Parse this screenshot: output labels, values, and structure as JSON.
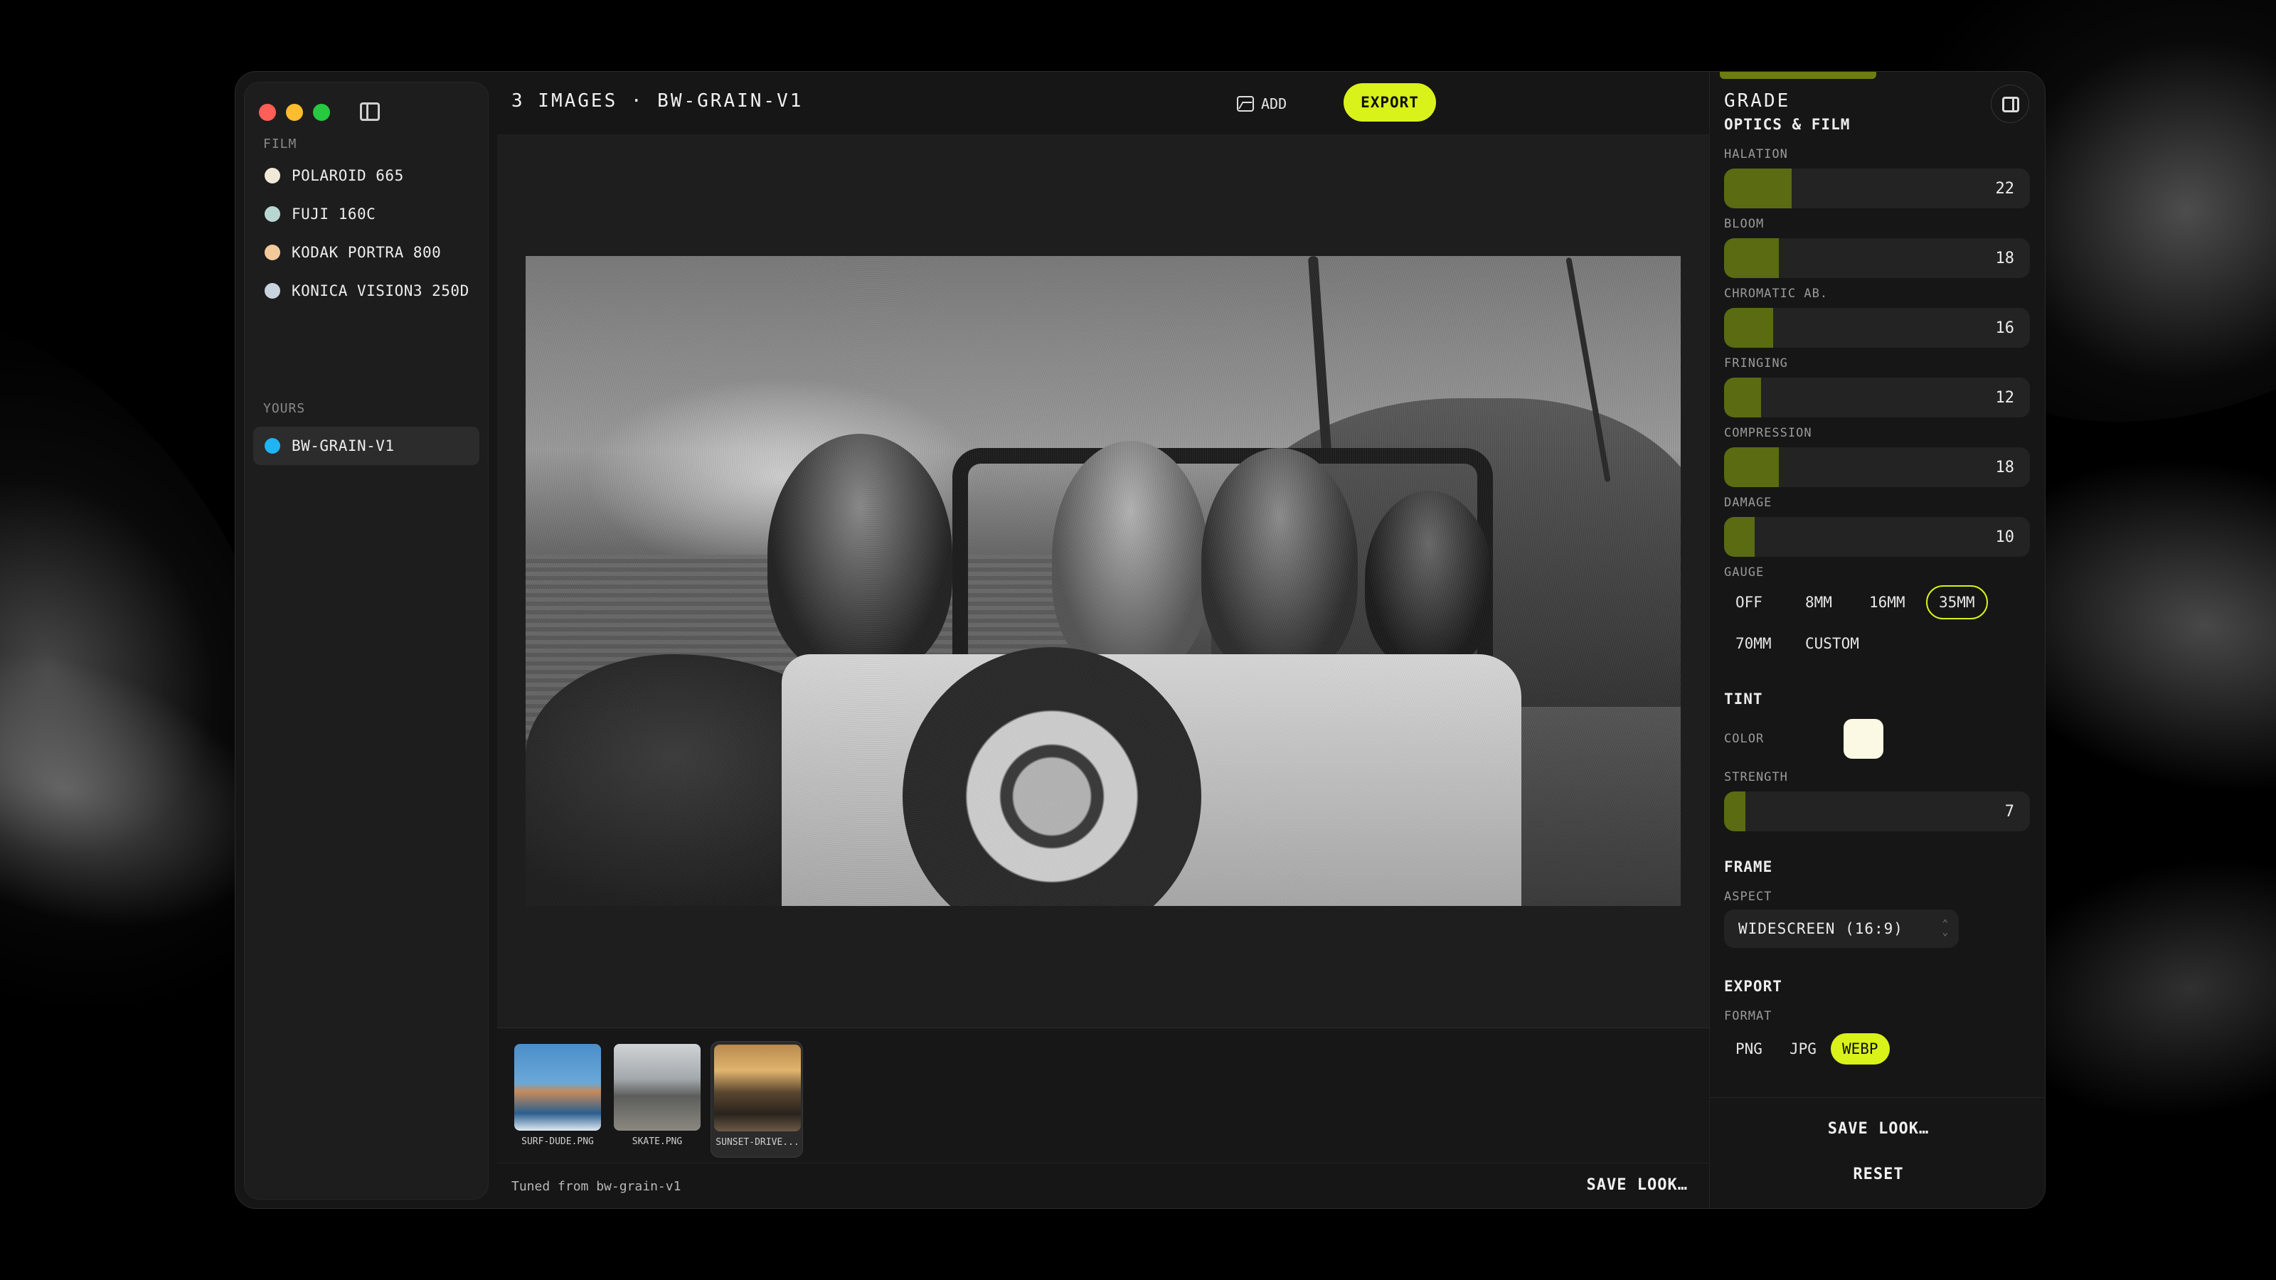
{
  "window": {
    "title": "3 IMAGES · BW-GRAIN-V1",
    "traffic_lights": [
      "#ff5f57",
      "#febc2e",
      "#28c840"
    ]
  },
  "sidebar": {
    "film_label": "FILM",
    "film_items": [
      {
        "label": "POLAROID 665",
        "color": "#f1e9d8"
      },
      {
        "label": "FUJI 160C",
        "color": "#b9d7d2"
      },
      {
        "label": "KODAK PORTRA 800",
        "color": "#f3c99b"
      },
      {
        "label": "KONICA VISION3 250D",
        "color": "#c9d3df"
      }
    ],
    "yours_label": "YOURS",
    "yours_items": [
      {
        "label": "BW-GRAIN-V1",
        "color": "#1fb4f2",
        "active": true
      }
    ]
  },
  "toolbar": {
    "add_label": "ADD",
    "export_label": "EXPORT"
  },
  "filmstrip": [
    {
      "caption": "SURF-DUDE.PNG"
    },
    {
      "caption": "SKATE.PNG"
    },
    {
      "caption": "SUNSET-DRIVE..."
    }
  ],
  "status": {
    "text": "Tuned from bw-grain-v1",
    "save_look": "SAVE LOOK…"
  },
  "panel": {
    "title": "GRADE",
    "optics_title": "OPTICS & FILM",
    "sliders": [
      {
        "label": "HALATION",
        "value": 22
      },
      {
        "label": "BLOOM",
        "value": 18
      },
      {
        "label": "CHROMATIC AB.",
        "value": 16
      },
      {
        "label": "FRINGING",
        "value": 12
      },
      {
        "label": "COMPRESSION",
        "value": 18
      },
      {
        "label": "DAMAGE",
        "value": 10
      }
    ],
    "gauge_label": "GAUGE",
    "gauge_options": [
      "OFF",
      "8MM",
      "16MM",
      "35MM",
      "70MM",
      "CUSTOM"
    ],
    "gauge_selected": "35MM",
    "tint_title": "TINT",
    "color_label": "COLOR",
    "tint_color": "#fbf8e4",
    "strength_label": "STRENGTH",
    "strength_value": 7,
    "frame_title": "FRAME",
    "aspect_label": "ASPECT",
    "aspect_value": "WIDESCREEN (16:9)",
    "export_title": "EXPORT",
    "format_label": "FORMAT",
    "format_options": [
      "PNG",
      "JPG",
      "WEBP"
    ],
    "format_selected": "WEBP",
    "save_look": "SAVE LOOK…",
    "reset": "RESET"
  },
  "colors": {
    "accent": "#d9f21a",
    "slider_fill": "#5a6b12"
  }
}
